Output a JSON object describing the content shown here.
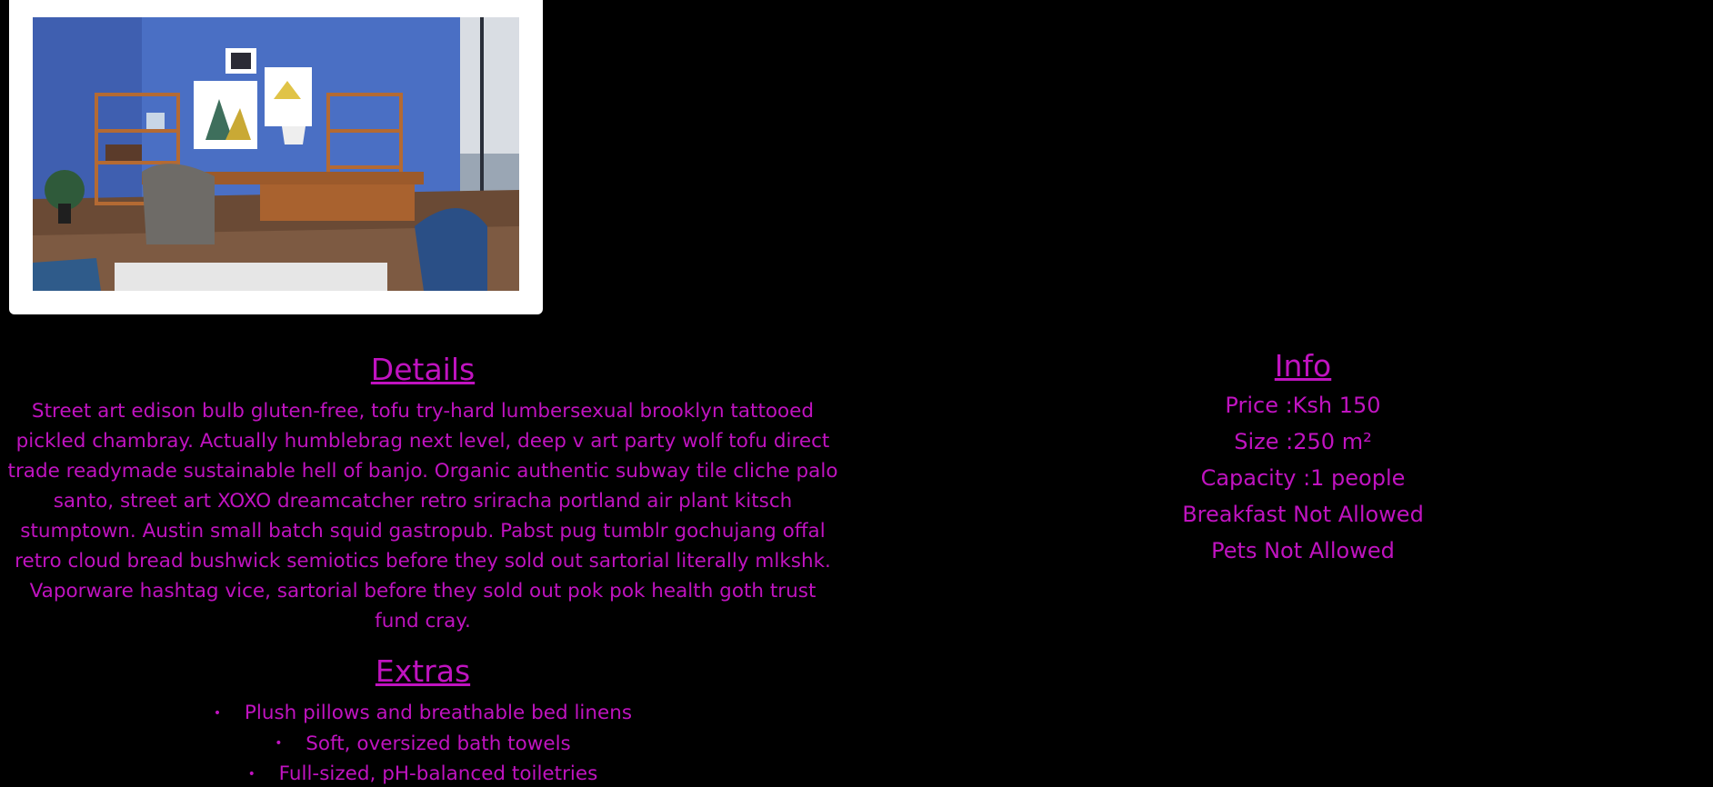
{
  "photo": {
    "alt_icon": "room-photo"
  },
  "details": {
    "title": "Details",
    "text": "Street art edison bulb gluten-free, tofu try-hard lumbersexual brooklyn tattooed pickled chambray. Actually humblebrag next level, deep v art party wolf tofu direct trade readymade sustainable hell of banjo. Organic authentic subway tile cliche palo santo, street art XOXO dreamcatcher retro sriracha portland air plant kitsch stumptown. Austin small batch squid gastropub. Pabst pug tumblr gochujang offal retro cloud bread bushwick semiotics before they sold out sartorial literally mlkshk. Vaporware hashtag vice, sartorial before they sold out pok pok health goth trust fund cray."
  },
  "extras": {
    "title": "Extras",
    "items": [
      "Plush pillows and breathable bed linens",
      "Soft, oversized bath towels",
      "Full-sized, pH-balanced toiletries"
    ]
  },
  "info": {
    "title": "Info",
    "price": "Price :Ksh 150",
    "size": "Size :250 m²",
    "capacity": "Capacity :1 people",
    "breakfast": "Breakfast Not Allowed",
    "pets": "Pets Not Allowed"
  },
  "colors": {
    "background": "#000000",
    "accent": "#c013c0",
    "card": "#ffffff"
  }
}
